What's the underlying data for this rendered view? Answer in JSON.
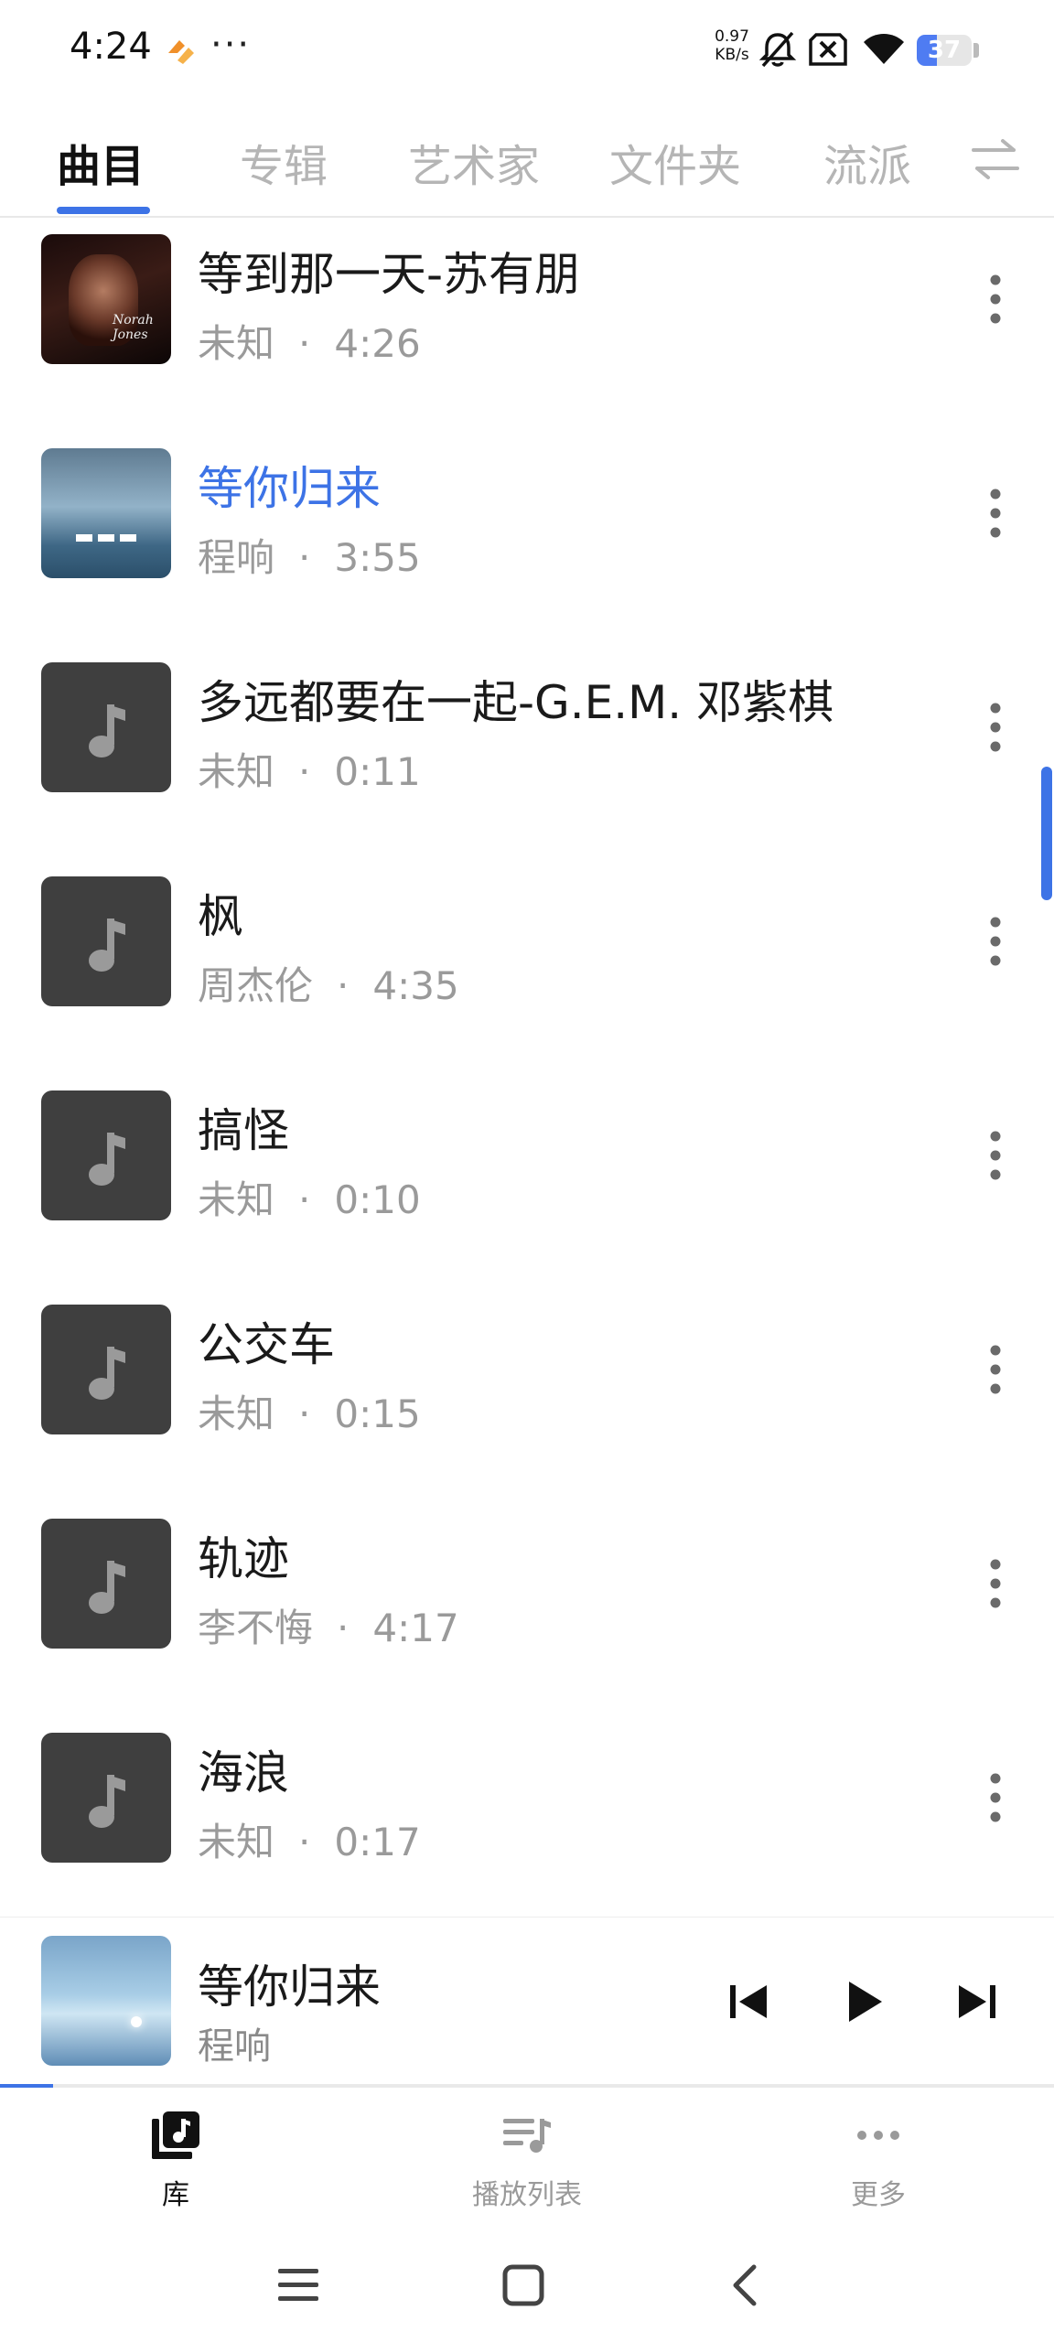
{
  "status_bar": {
    "time": "4:24",
    "more": "···",
    "net_speed_value": "0.97",
    "net_speed_unit": "KB/s",
    "battery_level": 37,
    "battery_text": "37",
    "icons": [
      "app-notification-icon",
      "bell-muted-icon",
      "sim-blocked-icon",
      "wifi-icon",
      "battery-icon"
    ]
  },
  "tabs": [
    {
      "label": "曲目",
      "active": true
    },
    {
      "label": "专辑",
      "active": false
    },
    {
      "label": "艺术家",
      "active": false
    },
    {
      "label": "文件夹",
      "active": false
    },
    {
      "label": "流派",
      "active": false
    }
  ],
  "tab_sort_icon": "swap-arrows-icon",
  "tracks": [
    {
      "title": "等到那一天-苏有朋",
      "artist": "未知",
      "duration": "4:26",
      "cover": "album-art",
      "playing": false
    },
    {
      "title": "等你归来",
      "artist": "程响",
      "duration": "3:55",
      "cover": "album-art",
      "playing": true
    },
    {
      "title": "多远都要在一起-G.E.M. 邓紫棋",
      "artist": "未知",
      "duration": "0:11",
      "cover": "music-note-icon",
      "playing": false
    },
    {
      "title": "枫",
      "artist": "周杰伦",
      "duration": "4:35",
      "cover": "music-note-icon",
      "playing": false
    },
    {
      "title": "搞怪",
      "artist": "未知",
      "duration": "0:10",
      "cover": "music-note-icon",
      "playing": false
    },
    {
      "title": "公交车",
      "artist": "未知",
      "duration": "0:15",
      "cover": "music-note-icon",
      "playing": false
    },
    {
      "title": "轨迹",
      "artist": "李不悔",
      "duration": "4:17",
      "cover": "music-note-icon",
      "playing": false
    },
    {
      "title": "海浪",
      "artist": "未知",
      "duration": "0:17",
      "cover": "music-note-icon",
      "playing": false
    }
  ],
  "separator": "·",
  "cover_art_text": "Norah Jones",
  "mini_player": {
    "title": "等你归来",
    "artist": "程响",
    "progress": 0.05,
    "controls": [
      "skip-previous-icon",
      "play-icon",
      "skip-next-icon"
    ]
  },
  "bottom_nav": [
    {
      "label": "库",
      "icon": "library-music-icon",
      "active": true
    },
    {
      "label": "播放列表",
      "icon": "playlist-icon",
      "active": false
    },
    {
      "label": "更多",
      "icon": "more-horizontal-icon",
      "active": false
    }
  ],
  "colors": {
    "accent": "#3d73e6",
    "text_primary": "#1a1a1a",
    "text_secondary": "#9a9a9a",
    "tab_inactive": "#b5b5b5",
    "cover_placeholder": "#3f3f3f"
  }
}
